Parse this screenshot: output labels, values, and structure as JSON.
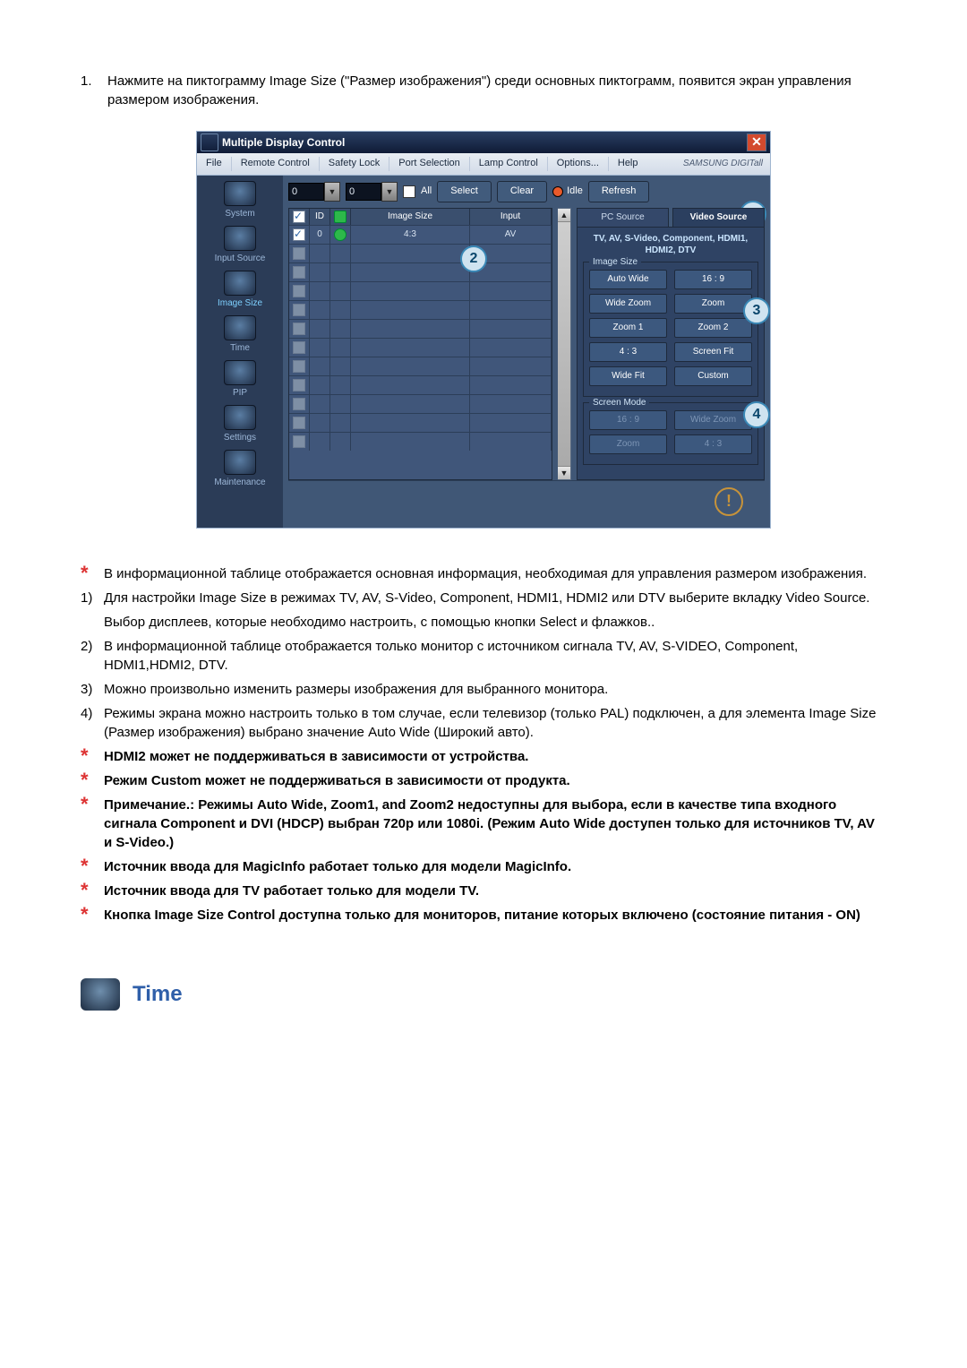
{
  "intro_number": "1.",
  "intro_text": "Нажмите на пиктограмму Image Size (\"Размер изображения\") среди основных пиктограмм, появится экран управления размером изображения.",
  "shot": {
    "window_title": "Multiple Display Control",
    "menu": [
      "File",
      "Remote Control",
      "Safety Lock",
      "Port Selection",
      "Lamp Control",
      "Options...",
      "Help"
    ],
    "brand": "SAMSUNG DIGITall",
    "side": [
      "System",
      "Input Source",
      "Image Size",
      "Time",
      "PIP",
      "Settings",
      "Maintenance"
    ],
    "side_active_index": 2,
    "tool": {
      "spin1": "0",
      "spin2": "0",
      "all": "All",
      "btn_select": "Select",
      "btn_clear": "Clear",
      "idle": "Idle",
      "btn_refresh": "Refresh"
    },
    "table": {
      "headers": {
        "id": "ID",
        "size": "Image Size",
        "input": "Input"
      },
      "row0": {
        "id": "0",
        "size": "4:3",
        "input": "AV"
      }
    },
    "tabs": {
      "pc": "PC Source",
      "video": "Video Source"
    },
    "panel_caption": "TV, AV, S-Video, Component, HDMI1, HDMI2, DTV",
    "group1_legend": "Image Size",
    "group1": [
      "Auto Wide",
      "16 : 9",
      "Wide Zoom",
      "Zoom",
      "Zoom 1",
      "Zoom 2",
      "4 : 3",
      "Screen Fit",
      "Wide Fit",
      "Custom"
    ],
    "group2_legend": "Screen Mode",
    "group2": [
      "16 : 9",
      "Wide Zoom",
      "Zoom",
      "4 : 3"
    ],
    "markers": [
      "1",
      "2",
      "3",
      "4"
    ]
  },
  "notes": [
    {
      "mk": "*",
      "bold": false,
      "text": "В информационной таблице отображается основная информация, необходимая для управления размером изображения."
    },
    {
      "mk": "1)",
      "bold": false,
      "text": "Для настройки Image Size в режимах TV, AV, S-Video, Component, HDMI1, HDMI2 или DTV выберите вкладку Video Source."
    },
    {
      "mk": "",
      "bold": false,
      "text": "Выбор дисплеев, которые необходимо настроить, с помощью кнопки Select и флажков.."
    },
    {
      "mk": "2)",
      "bold": false,
      "text": "В информационной таблице отображается только монитор с источником сигнала TV, AV, S-VIDEO, Component, HDMI1,HDMI2, DTV."
    },
    {
      "mk": "3)",
      "bold": false,
      "text": "Можно произвольно изменить размеры изображения для выбранного монитора."
    },
    {
      "mk": "4)",
      "bold": false,
      "text": "Режимы экрана можно настроить только в том случае, если телевизор (только PAL) подключен, а для элемента Image Size (Размер изображения) выбрано значение Auto Wide (Широкий авто)."
    },
    {
      "mk": "*",
      "bold": true,
      "text": "HDMI2 может не поддерживаться в зависимости от устройства."
    },
    {
      "mk": "*",
      "bold": true,
      "text": "Режим Custom может не поддерживаться в зависимости от продукта."
    },
    {
      "mk": "*",
      "bold": true,
      "text": "Примечание.: Режимы Auto Wide, Zoom1, and Zoom2 недоступны для выбора, если в качестве типа входного сигнала Component и DVI (HDCP) выбран 720p или 1080i. (Режим Auto Wide доступен только для источников TV, AV и S-Video.)"
    },
    {
      "mk": "*",
      "bold": true,
      "text": "Источник ввода для MagicInfo работает только для модели MagicInfo."
    },
    {
      "mk": "*",
      "bold": true,
      "text": "Источник ввода для TV работает только для модели TV."
    },
    {
      "mk": "*",
      "bold": true,
      "text": "Кнопка Image Size Control доступна только для мониторов, питание которых включено (состояние питания - ON)"
    }
  ],
  "section_title": "Time"
}
